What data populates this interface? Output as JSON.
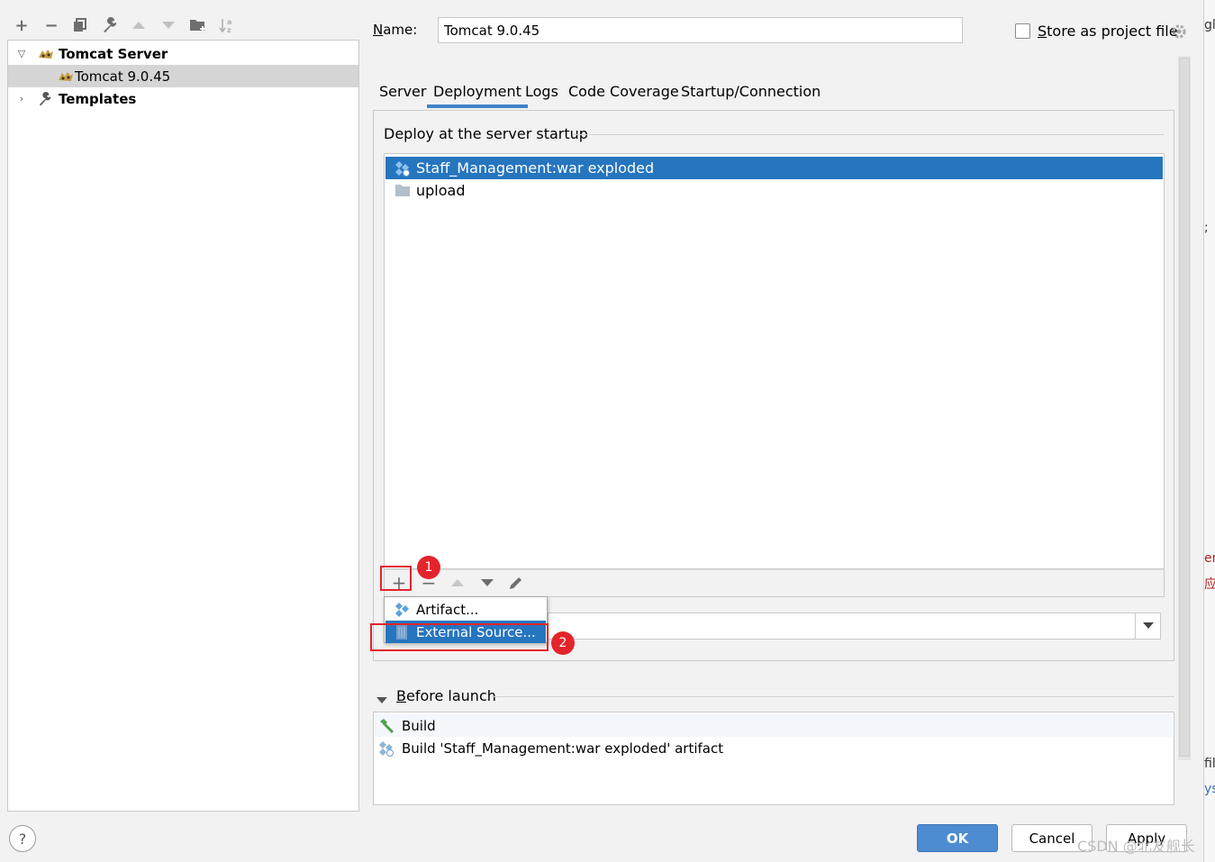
{
  "toolbar": {
    "icons": [
      "plus-icon",
      "minus-icon",
      "copy-icon",
      "wrench-icon",
      "arrow-up-icon",
      "arrow-down-icon",
      "folder-add-icon",
      "sort-icon"
    ],
    "add": "+",
    "remove": "−"
  },
  "tree": {
    "items": [
      {
        "label": "Tomcat Server",
        "expanded": true,
        "icon": "tomcat-icon"
      },
      {
        "label": "Tomcat 9.0.45",
        "selected": true,
        "icon": "tomcat-icon"
      },
      {
        "label": "Templates",
        "expanded": false,
        "icon": "wrench-icon"
      }
    ]
  },
  "form": {
    "name_label_u": "N",
    "name_label_rest": "ame:",
    "name_value": "Tomcat 9.0.45",
    "store_u": "S",
    "store_rest": "tore as project file",
    "store_checked": false
  },
  "tabs": [
    {
      "label": "Server"
    },
    {
      "label": "Deployment",
      "active": true
    },
    {
      "label": "Logs"
    },
    {
      "label": "Code Coverage"
    },
    {
      "label": "Startup/Connection"
    }
  ],
  "deployment": {
    "section_title": "Deploy at the server startup",
    "items": [
      {
        "label": "Staff_Management:war exploded",
        "selected": true,
        "icon": "artifact-icon"
      },
      {
        "label": "upload",
        "icon": "folder-icon"
      }
    ],
    "popup": [
      {
        "label": "Artifact...",
        "icon": "artifact-icon"
      },
      {
        "label": "External Source...",
        "icon": "external-source-icon",
        "selected": true
      }
    ],
    "application_context": ""
  },
  "annotations": {
    "badge1": "1",
    "badge2": "2",
    "color": "#e3242b"
  },
  "before_launch": {
    "title_u": "B",
    "title_rest": "efore launch",
    "items": [
      {
        "label": "Build",
        "icon": "hammer-icon"
      },
      {
        "label": "Build 'Staff_Management:war exploded' artifact",
        "icon": "artifact-icon"
      }
    ]
  },
  "buttons": {
    "ok": "OK",
    "cancel": "Cancel",
    "apply": "Apply",
    "help": "?"
  },
  "watermark": "CSDN @北友舰长",
  "edge_fragments": {
    "top": "gl",
    "mid1": "er",
    "mid2": "应",
    "mid3": "fil",
    "mid4": "ys",
    "mid5": ";"
  },
  "colors": {
    "selection": "#2675bf",
    "tab_underline": "#4083c9",
    "ok": "#4e8cd1"
  }
}
